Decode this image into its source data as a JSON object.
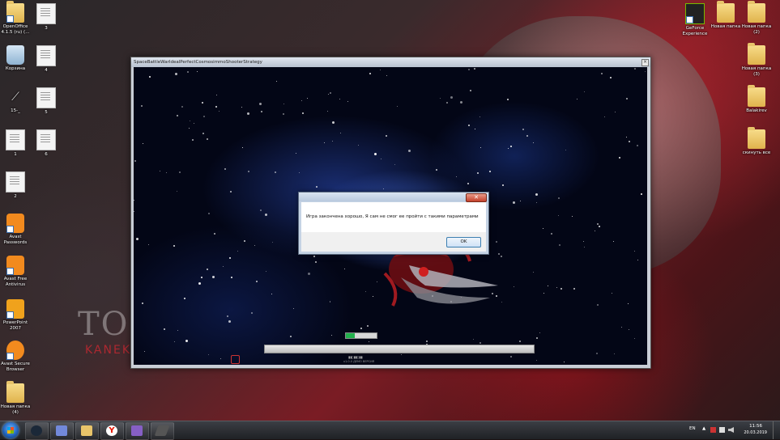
{
  "desktop": {
    "left_icons": [
      {
        "label": "OpenOffice 4.1.5 (ru) (...",
        "icon": "folder-icon"
      },
      {
        "label": "3",
        "icon": "document-icon"
      },
      {
        "label": "Корзина",
        "icon": "recycle-bin-icon"
      },
      {
        "label": "4",
        "icon": "document-icon"
      },
      {
        "label": "15-_",
        "icon": "shortcut-icon"
      },
      {
        "label": "5",
        "icon": "document-icon"
      },
      {
        "label": "1",
        "icon": "document-icon"
      },
      {
        "label": "6",
        "icon": "document-icon"
      },
      {
        "label": "2",
        "icon": "document-icon"
      },
      {
        "label": "Avast Passwords",
        "icon": "avast-passwords-icon"
      },
      {
        "label": "Avast Free Antivirus",
        "icon": "avast-antivirus-icon"
      },
      {
        "label": "PowerPoint 2007",
        "icon": "powerpoint-icon"
      },
      {
        "label": "Avast Secure Browser",
        "icon": "avast-browser-icon"
      },
      {
        "label": "Новая папка (4)",
        "icon": "folder-icon"
      }
    ],
    "right_icons": [
      {
        "label": "GeForce Experience",
        "icon": "nvidia-icon"
      },
      {
        "label": "Новая папка",
        "icon": "folder-icon"
      },
      {
        "label": "Новая папка (2)",
        "icon": "folder-icon"
      },
      {
        "label": "Новая папка (3)",
        "icon": "folder-icon"
      },
      {
        "label": "Balakirev",
        "icon": "folder-icon"
      },
      {
        "label": "скинуть все",
        "icon": "folder-icon"
      }
    ],
    "wallpaper_text": {
      "big": "TO",
      "small": "KANEK"
    }
  },
  "game_window": {
    "title": "SpaceBattleWarIdealPerfectCosmosimmoShooterStrategy",
    "close_glyph": "×",
    "progress_small_fraction": 0.3,
    "progress_caption": "▮▮▯▮▮▯▮▮",
    "progress_caption_2": "v1.0.0 ДЕМО ВЕРСИЯ"
  },
  "dialog": {
    "message": "Игра закончена хорошо, Я сам не смог ее пройти с такими параметрами",
    "ok_label": "OK",
    "close_glyph": "✕"
  },
  "taskbar": {
    "pinned": [
      {
        "name": "steam",
        "icon": "steam-icon",
        "color": "#1b2838"
      },
      {
        "name": "discord",
        "icon": "discord-icon",
        "color": "#7289da"
      },
      {
        "name": "explorer",
        "icon": "folder-icon",
        "color": "#e8c46a"
      },
      {
        "name": "yandex",
        "icon": "yandex-browser-icon",
        "color": "#e61400"
      },
      {
        "name": "visual-studio",
        "icon": "visual-studio-icon",
        "color": "#865fc5"
      },
      {
        "name": "app",
        "icon": "generic-app-icon",
        "color": "#555555"
      }
    ],
    "language": "EN",
    "tray_arrow": "▲",
    "clock_time": "11:56",
    "clock_date": "20.03.2019"
  },
  "colors": {
    "accent_red": "#c4402a",
    "progress_green": "#22b14c"
  }
}
